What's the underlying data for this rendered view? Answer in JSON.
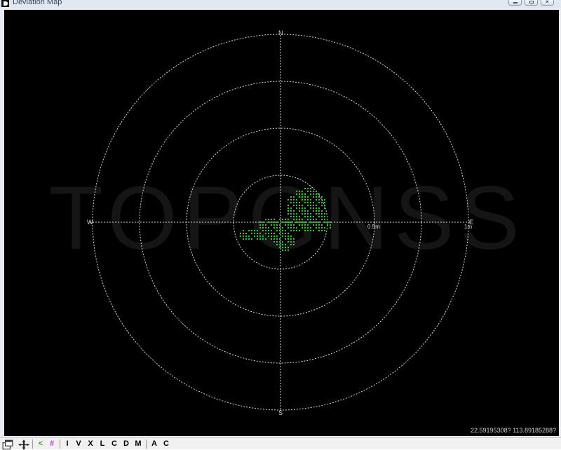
{
  "window": {
    "title": "Deviation Map"
  },
  "map": {
    "watermark": "TOPGNSS",
    "compass": {
      "north": "N",
      "south": "S",
      "east": "E",
      "west": "W"
    },
    "ring_labels": [
      "0.5m",
      "1m"
    ],
    "coordinate_readout": "22.59195308? 113.89185288?",
    "colors": {
      "background": "#000000",
      "grid": "#d8d8d8",
      "points": "#22cc22"
    }
  },
  "toolbar": {
    "icons": [
      "window-layout-icon",
      "move-icon"
    ],
    "glyph_buttons": [
      {
        "label": "<",
        "color": "#22aa22"
      },
      {
        "label": "#",
        "color": "#cc33cc"
      }
    ],
    "letter_buttons": [
      "I",
      "V",
      "X",
      "L",
      "C",
      "D",
      "M",
      "A",
      "C"
    ]
  }
}
